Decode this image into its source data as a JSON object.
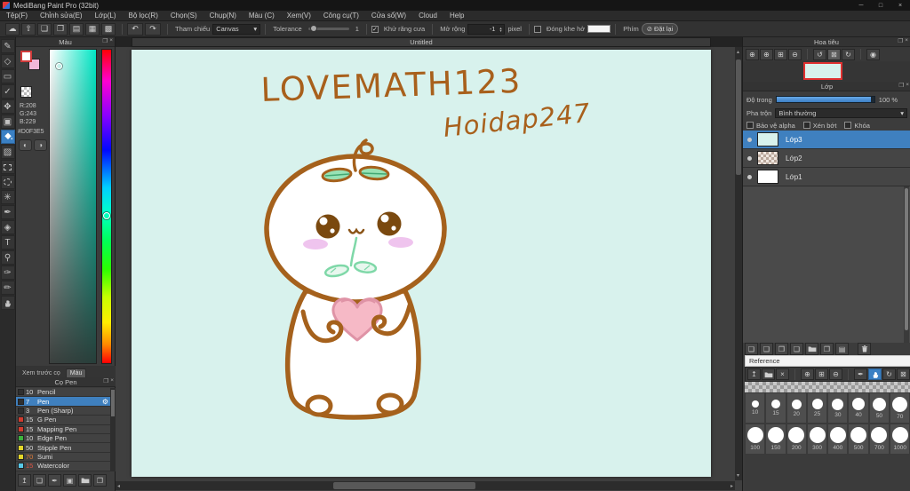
{
  "window": {
    "title": "MediBang Paint Pro (32bit)"
  },
  "menu": {
    "items": [
      "Tệp(F)",
      "Chỉnh sửa(E)",
      "Lớp(L)",
      "Bộ lọc(R)",
      "Chọn(S)",
      "Chụp(N)",
      "Màu (C)",
      "Xem(V)",
      "Công cụ(T)",
      "Cửa sổ(W)",
      "Cloud",
      "Help"
    ]
  },
  "toolbar": {
    "reference_label": "Tham chiếu",
    "reference_value": "Canvas",
    "tolerance_label": "Tolerance",
    "tolerance_value": "1",
    "antialias_label": "Khử răng cưa",
    "expand_label": "Mở rộng",
    "expand_value": "-1",
    "expand_unit": "pixel",
    "close_gap_label": "Đóng khe hở",
    "key_label": "Phím",
    "reset_label": "Đặt lại"
  },
  "color_panel": {
    "title": "Màu",
    "r": "R:208",
    "g": "G:243",
    "b": "B:229",
    "hex": "#D0F3E5"
  },
  "brush_panel": {
    "preview_tab": "Xem trước cọ",
    "color_tab": "Màu",
    "title": "Cọ Pen",
    "brushes": [
      {
        "size": "10",
        "name": "Pencil",
        "swatch": "#2f2f2f"
      },
      {
        "size": "7",
        "name": "Pen",
        "swatch": "#2f2f2f",
        "selected": true
      },
      {
        "size": "3",
        "name": "Pen (Sharp)",
        "swatch": "#2f2f2f"
      },
      {
        "size": "15",
        "name": "G Pen",
        "swatch": "#d23b2e"
      },
      {
        "size": "15",
        "name": "Mapping Pen",
        "swatch": "#d23b2e"
      },
      {
        "size": "10",
        "name": "Edge Pen",
        "swatch": "#3db33d"
      },
      {
        "size": "50",
        "name": "Stipple Pen",
        "swatch": "#e3d62a"
      },
      {
        "size": "70",
        "name": "Sumi",
        "swatch": "#e3d62a",
        "size_color": "#e07b39"
      },
      {
        "size": "15",
        "name": "Watercolor",
        "swatch": "#57c8e8",
        "size_color": "#e05545"
      }
    ]
  },
  "document": {
    "tab": "Untitled",
    "canvas_text1": "LOVEMATH123",
    "canvas_text2": "Hoidap247"
  },
  "navigator": {
    "title": "Hoa tiêu"
  },
  "layers_panel": {
    "title": "Lớp",
    "opacity_label": "Độ trong",
    "opacity_value": "100 %",
    "blend_label": "Pha trộn",
    "blend_value": "Bình thường",
    "checkbox_alpha": "Bảo vệ alpha",
    "checkbox_clip": "Xén bớt",
    "checkbox_lock": "Khóa",
    "layers": [
      {
        "name": "Lớp3",
        "selected": true,
        "thumb": "cyan"
      },
      {
        "name": "Lớp2",
        "thumb": "checker"
      },
      {
        "name": "Lớp1",
        "thumb": "white"
      }
    ]
  },
  "reference_panel": {
    "title": "Reference",
    "sizes_row1": [
      "10",
      "15",
      "20",
      "25",
      "30",
      "40",
      "50",
      "70"
    ],
    "sizes_row2": [
      "100",
      "150",
      "200",
      "300",
      "400",
      "500",
      "700",
      "1000"
    ]
  },
  "colors": {
    "accent_blue": "#3f80bf",
    "canvas_bg": "#d8f2ed",
    "drawing_brown": "#a5611c",
    "heart_pink": "#f6b9c6",
    "sprout_green": "#8fdfb0"
  },
  "icons": {
    "minimize": "─",
    "maximize": "□",
    "close": "×",
    "cloud": "☁",
    "share": "⇧",
    "comment": "❏",
    "chat": "❐",
    "image_add": "▤",
    "grid": "▦",
    "new_canvas": "▩",
    "undo": "↶",
    "redo": "↷",
    "dropdown": "▾",
    "check": "✓",
    "spin_up": "▴",
    "spin_down": "▾",
    "reset": "⊘",
    "detach": "❐",
    "panel_close": "×",
    "brush": "✎",
    "eraser": "◇",
    "rect": "▭",
    "operate": "✓",
    "move": "✥",
    "dot": "▣",
    "gradient": "▨",
    "wand": "✳",
    "select_pen": "✒",
    "select_eraser": "◈",
    "text": "T",
    "magnifier": "⚲",
    "eyedropper": "✑",
    "frame": "✏",
    "zoom_in": "⊕",
    "zoom_fit": "⊞",
    "zoom_out": "⊖",
    "rotate_left": "↺",
    "rotate_reset": "⊠",
    "rotate_right": "↻",
    "flip": "◉",
    "upload": "↥",
    "page": "❏",
    "page2": "❑",
    "page3": "❒",
    "copy": "❐",
    "gear": "⚙",
    "pan": "✥",
    "arrow_left": "◂",
    "arrow_right": "▸",
    "arrow_up": "▴",
    "arrow_down": "▾"
  }
}
